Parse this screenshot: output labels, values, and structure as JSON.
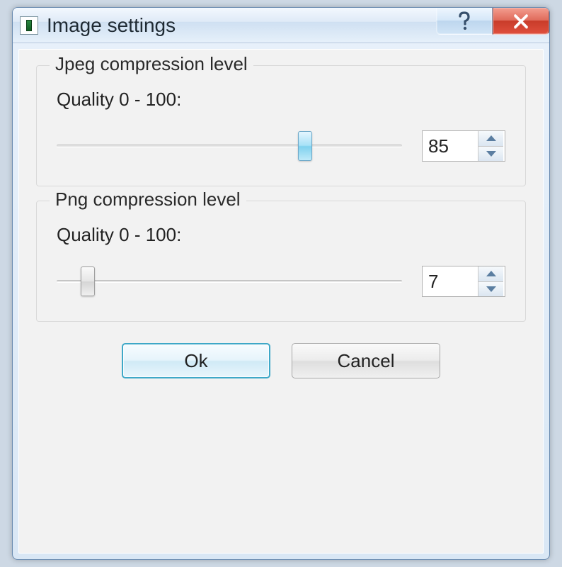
{
  "window": {
    "title": "Image settings"
  },
  "jpeg": {
    "legend": "Jpeg compression level",
    "label": "Quality 0 - 100:",
    "value": "85",
    "slider_percent": 72
  },
  "png": {
    "legend": "Png compression level",
    "label": "Quality 0 - 100:",
    "value": "7",
    "slider_percent": 9
  },
  "buttons": {
    "ok": "Ok",
    "cancel": "Cancel"
  }
}
